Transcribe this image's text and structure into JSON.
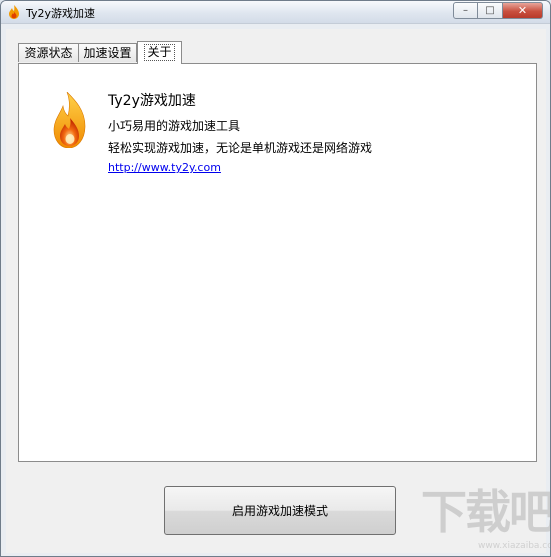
{
  "window": {
    "title": "Ty2y游戏加速",
    "controls": {
      "minimize": "–",
      "maximize": "□",
      "close": "✕"
    }
  },
  "tabs": [
    {
      "label": "资源状态",
      "active": false
    },
    {
      "label": "加速设置",
      "active": false
    },
    {
      "label": "关于",
      "active": true
    }
  ],
  "about": {
    "app_name": "Ty2y游戏加速",
    "line1": "小巧易用的游戏加速工具",
    "line2": "轻松实现游戏加速，无论是单机游戏还是网络游戏",
    "link": "http://www.ty2y.com",
    "icon": "flame-icon"
  },
  "actions": {
    "enable_button": "启用游戏加速模式"
  },
  "watermark": {
    "logo": "下载吧",
    "sub": "www.xiazaiba.com"
  },
  "colors": {
    "link": "#0000ee",
    "flame_outer": "#f5a000",
    "flame_inner": "#e64a00"
  }
}
